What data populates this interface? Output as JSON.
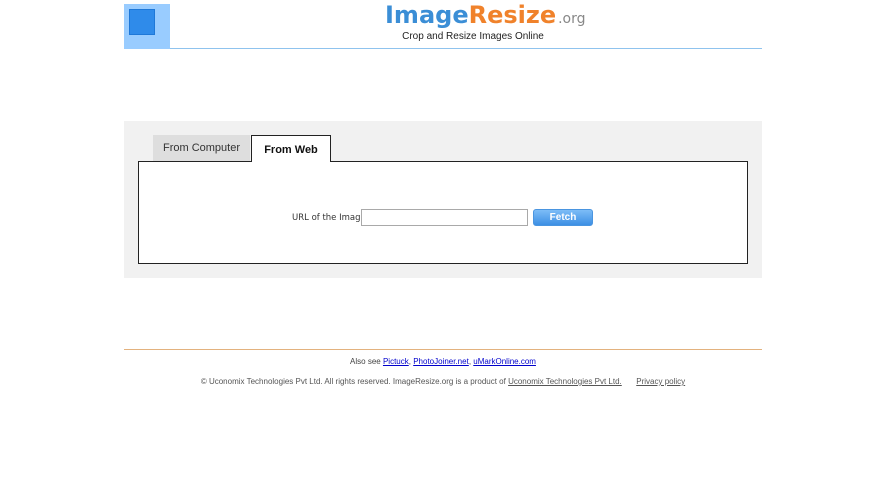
{
  "header": {
    "logo_part1": "Image",
    "logo_part2": "Resize",
    "logo_part3": ".org",
    "tagline": "Crop and Resize Images Online"
  },
  "tabs": [
    {
      "label": "From Computer",
      "active": false
    },
    {
      "label": "From Web",
      "active": true
    }
  ],
  "form": {
    "url_label": "URL of the Image",
    "url_value": "",
    "fetch_label": "Fetch"
  },
  "footer": {
    "also_see_prefix": "Also see",
    "links": [
      "Pictuck",
      "PhotoJoiner.net",
      "uMarkOnline.com"
    ],
    "copyright_text": "© Uconomix Technologies Pvt Ltd. All rights reserved. ImageResize.org is a product of",
    "company_link": "Uconomix Technologies Pvt Ltd.",
    "privacy_link": "Privacy policy"
  },
  "colors": {
    "brand_blue": "#3b8ed6",
    "brand_orange": "#f0822b",
    "logo_square_light": "#99ccff",
    "logo_square_dark": "#2f8bea",
    "panel_bg": "#f1f1f1",
    "fetch_button": "#5aa3ee"
  }
}
